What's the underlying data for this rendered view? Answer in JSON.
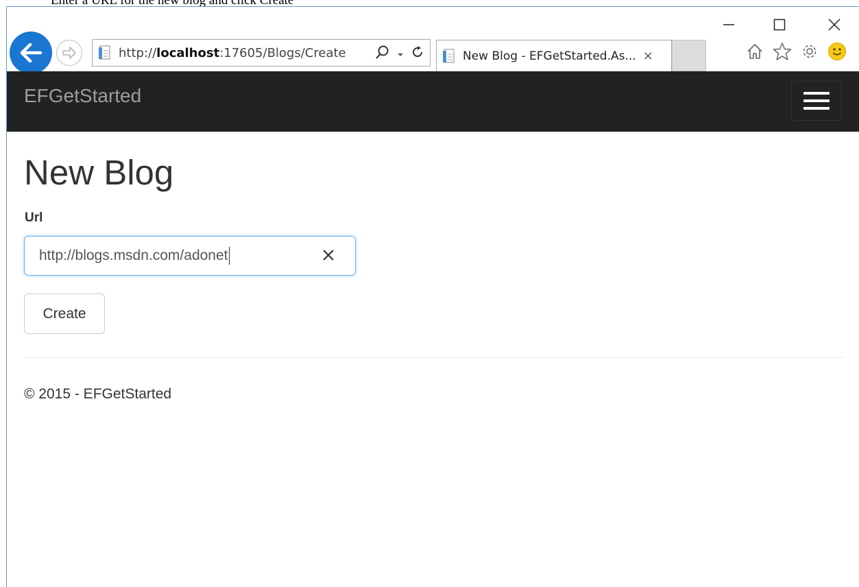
{
  "caption": "Enter a URL for the new blog and click Create",
  "browser": {
    "address_prefix": "http://",
    "address_host": "localhost",
    "address_rest": ":17605/Blogs/Create",
    "tab_title": "New Blog - EFGetStarted.As...",
    "tab_close": "×"
  },
  "navbar": {
    "brand": "EFGetStarted"
  },
  "main": {
    "title": "New Blog",
    "url_label": "Url",
    "url_value": "http://blogs.msdn.com/adonet",
    "create_label": "Create"
  },
  "footer": {
    "text": "© 2015 - EFGetStarted"
  },
  "icons": {
    "back": "back-arrow-icon",
    "forward": "forward-arrow-icon",
    "search": "search-icon",
    "refresh": "refresh-icon",
    "home": "home-icon",
    "favorites": "star-icon",
    "settings": "gear-icon",
    "feedback": "smiley-icon",
    "menu": "hamburger-icon",
    "clear": "clear-x-icon"
  },
  "colors": {
    "navbar_bg": "#222222",
    "brand_text": "#9d9d9d",
    "back_button": "#1976d2",
    "input_focus": "#66afe9"
  }
}
